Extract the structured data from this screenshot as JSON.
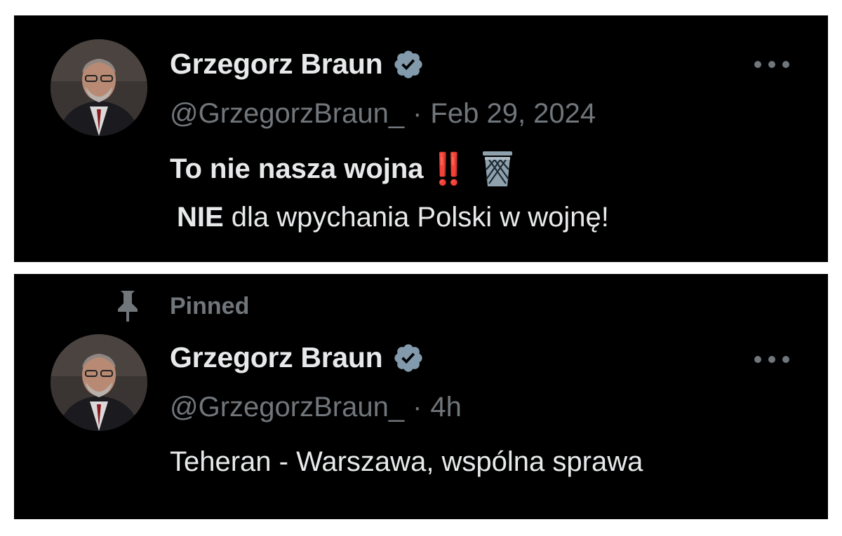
{
  "tweets": [
    {
      "author_name": "Grzegorz Braun",
      "handle": "@GrzegorzBraun_",
      "separator": "·",
      "time": "Feb 29, 2024",
      "line1_text": "To nie nasza wojna",
      "line1_emoji": "‼️",
      "line2_bold": "NIE",
      "line2_text": " dla wpychania Polski w wojnę!",
      "icons": [
        "verified-badge-icon",
        "more-options-icon",
        "wastebasket-icon"
      ]
    },
    {
      "pinned_label": "Pinned",
      "author_name": "Grzegorz Braun",
      "handle": "@GrzegorzBraun_",
      "separator": "·",
      "time": "4h",
      "text": "Teheran - Warszawa, wspólna sprawa",
      "icons": [
        "pin-icon",
        "verified-badge-icon",
        "more-options-icon"
      ]
    }
  ],
  "colors": {
    "background": "#000000",
    "primary_text": "#e7e9ea",
    "secondary_text": "#71767b",
    "verified_badge": "#829aab",
    "emoji_red": "#e0243a"
  }
}
